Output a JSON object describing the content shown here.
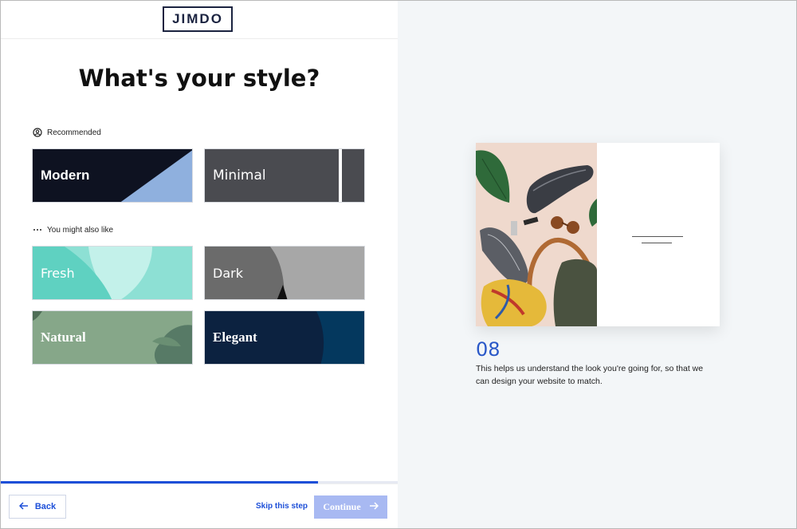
{
  "brand": {
    "logo_text": "JIMDO"
  },
  "page": {
    "title": "What's your style?"
  },
  "sections": {
    "recommended_label": "Recommended",
    "more_label": "You might also like"
  },
  "styles": {
    "modern": "Modern",
    "minimal": "Minimal",
    "fresh": "Fresh",
    "dark": "Dark",
    "natural": "Natural",
    "elegant": "Elegant"
  },
  "progress": {
    "fraction": 0.8
  },
  "footer": {
    "back_label": "Back",
    "skip_label": "Skip this step",
    "continue_label": "Continue"
  },
  "info": {
    "step_number": "08",
    "description": "This helps us understand the look you're going for, so that we can design your website to match."
  },
  "colors": {
    "accent": "#1d4fd8",
    "continue_disabled": "#a8b9f2"
  }
}
